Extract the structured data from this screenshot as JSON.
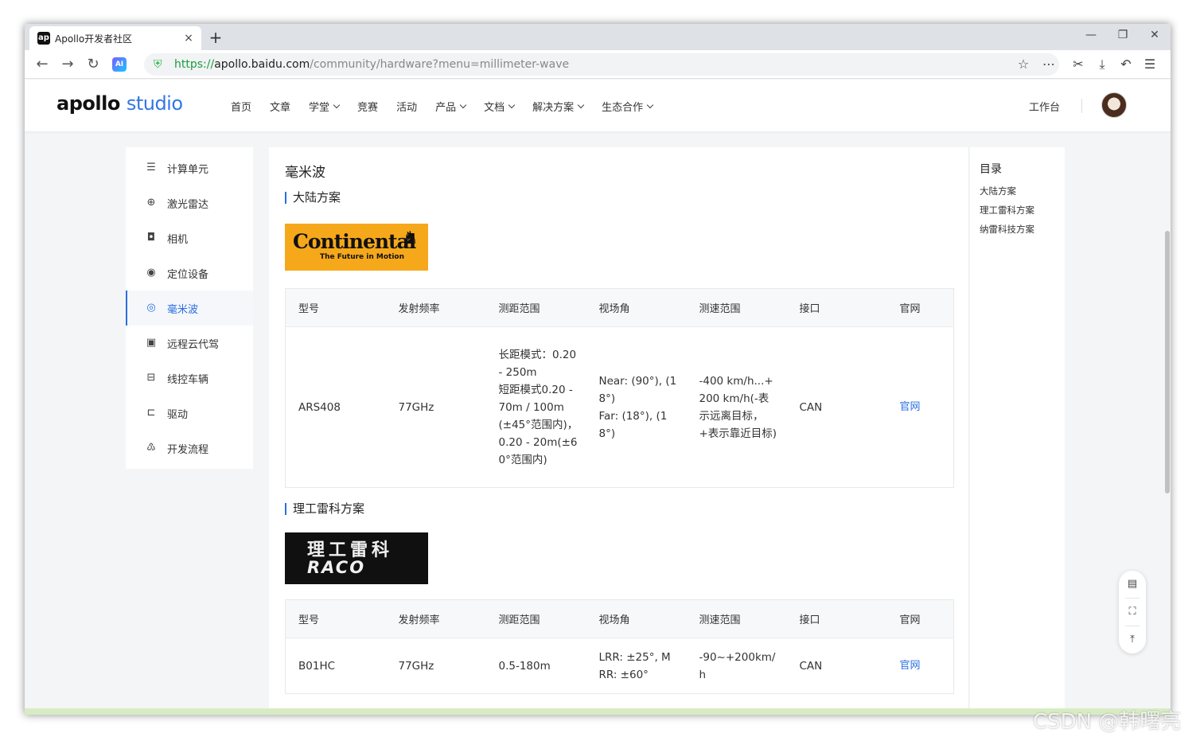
{
  "browser": {
    "tab_title": "Apollo开发者社区",
    "tab_favicon": "ap",
    "tab_close": "×",
    "new_tab": "+",
    "url_scheme": "https://",
    "url_host": "apollo.baidu.com",
    "url_path": "/community/hardware?menu=millimeter-wave",
    "ai_label": "AI"
  },
  "header": {
    "logo_main": "apollo",
    "logo_sub": "studio",
    "nav": [
      {
        "label": "首页",
        "dropdown": false
      },
      {
        "label": "文章",
        "dropdown": false
      },
      {
        "label": "学堂",
        "dropdown": true
      },
      {
        "label": "竞赛",
        "dropdown": false
      },
      {
        "label": "活动",
        "dropdown": false
      },
      {
        "label": "产品",
        "dropdown": true
      },
      {
        "label": "文档",
        "dropdown": true
      },
      {
        "label": "解决方案",
        "dropdown": true
      },
      {
        "label": "生态合作",
        "dropdown": true
      }
    ],
    "workbench": "工作台"
  },
  "sidebar": {
    "items": [
      {
        "label": "计算单元",
        "icon": "database-icon",
        "glyph": "☰"
      },
      {
        "label": "激光雷达",
        "icon": "crosshair-icon",
        "glyph": "⊕"
      },
      {
        "label": "相机",
        "icon": "camera-icon",
        "glyph": "◘"
      },
      {
        "label": "定位设备",
        "icon": "location-pin-icon",
        "glyph": "◉"
      },
      {
        "label": "毫米波",
        "icon": "radar-wave-icon",
        "glyph": "◎",
        "active": true
      },
      {
        "label": "远程云代驾",
        "icon": "monitor-user-icon",
        "glyph": "▣"
      },
      {
        "label": "线控车辆",
        "icon": "car-icon",
        "glyph": "⊟"
      },
      {
        "label": "驱动",
        "icon": "printer-icon",
        "glyph": "⊏"
      },
      {
        "label": "开发流程",
        "icon": "flow-icon",
        "glyph": "♳"
      }
    ]
  },
  "main": {
    "title": "毫米波",
    "sections": [
      {
        "title": "大陆方案",
        "brand_name": "Continental",
        "brand_tag": "The Future in Motion",
        "headers": [
          "型号",
          "发射频率",
          "测距范围",
          "视场角",
          "测速范围",
          "接口",
          "官网"
        ],
        "row": {
          "model": "ARS408",
          "frequency": "77GHz",
          "range_lines": [
            "长距模式：0.20 - 250m",
            "短距模式0.20 - 70m / 100m (±45°范围内)，0.20 - 20m(±60°范围内)"
          ],
          "fov_lines": [
            "Near: (90°), (18°)",
            "Far: (18°), (18°)"
          ],
          "speed": "-400 km/h...+200 km/h(-表示远离目标，+表示靠近目标)",
          "interface": "CAN",
          "link": "官网"
        }
      },
      {
        "title": "理工雷科方案",
        "brand_name_cn": "理工雷科",
        "brand_name_en": "RACO",
        "headers": [
          "型号",
          "发射频率",
          "测距范围",
          "视场角",
          "测速范围",
          "接口",
          "官网"
        ],
        "row": {
          "model": "B01HC",
          "frequency": "77GHz",
          "range": "0.5-180m",
          "fov_lines": [
            "LRR: ±25°, M",
            "RR: ±60°"
          ],
          "speed": "-90~+200km/h",
          "interface": "CAN",
          "link": "官网"
        }
      }
    ]
  },
  "toc": {
    "title": "目录",
    "items": [
      "大陆方案",
      "理工雷科方案",
      "纳雷科技方案"
    ]
  },
  "float_tools": [
    "feedback-icon",
    "scan-icon",
    "back-to-top-icon"
  ],
  "watermark": "CSDN @韩曙亮",
  "colors": {
    "accent": "#2a6fe0",
    "continental": "#f6a81b"
  }
}
